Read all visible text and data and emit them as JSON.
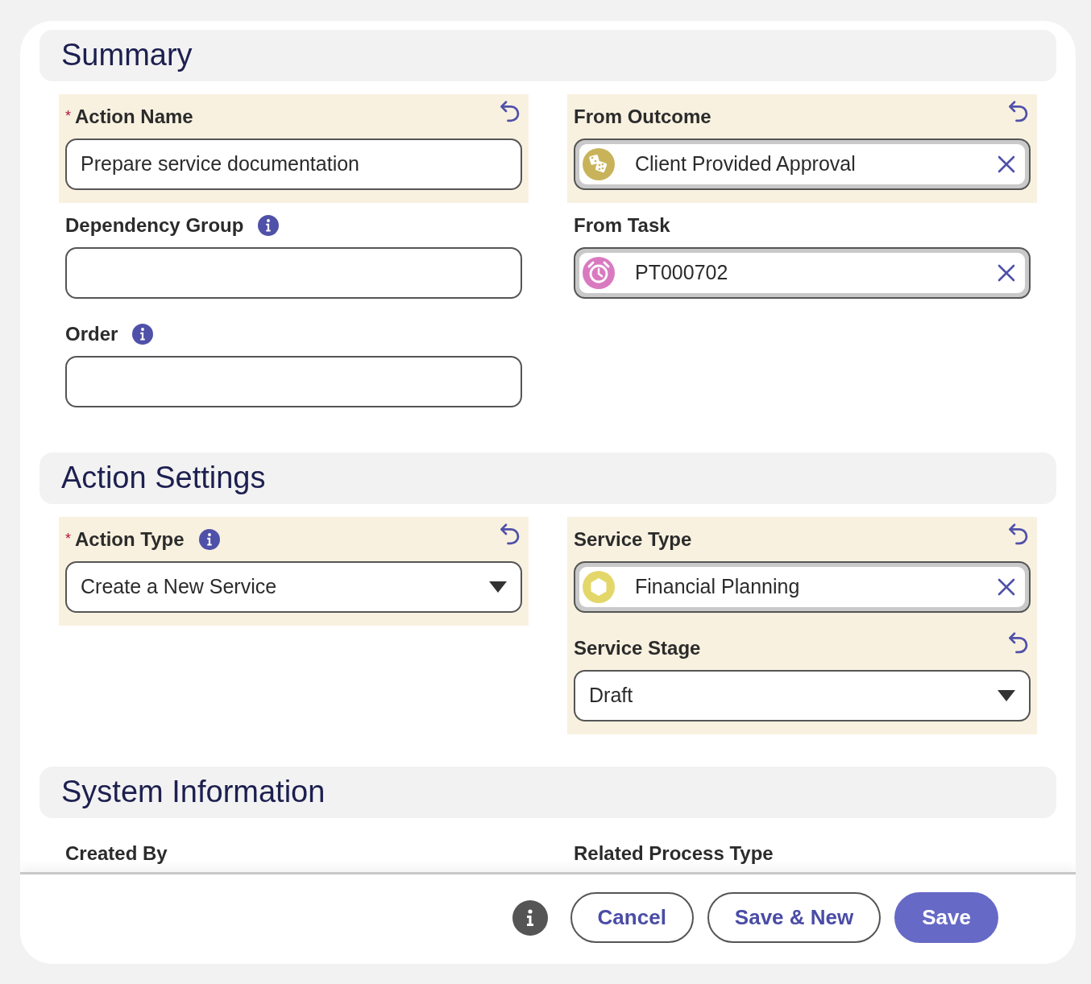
{
  "sections": [
    {
      "title": "Summary",
      "columns": [
        [
          {
            "label": "Action Name",
            "required_mark": "*",
            "undo": true,
            "highlighted": true,
            "kind": "text",
            "value": "Prepare service documentation"
          },
          {
            "label": "Dependency Group",
            "info": true,
            "kind": "text"
          },
          {
            "label": "Order",
            "info": true,
            "kind": "text"
          }
        ],
        [
          {
            "label": "From Outcome",
            "undo": true,
            "highlighted": true,
            "kind": "lookup",
            "value": "Client Provided Approval"
          },
          {
            "label": "From Task",
            "kind": "lookup",
            "value": "PT000702"
          }
        ]
      ]
    },
    {
      "title": "Action Settings",
      "columns": [
        [
          {
            "label": "Action Type",
            "required_mark": "*",
            "info": true,
            "undo": true,
            "highlighted": true,
            "kind": "select",
            "value": "Create a New Service"
          }
        ],
        [
          {
            "label": "Service Type",
            "undo": true,
            "highlighted": true,
            "kind": "lookup",
            "value": "Financial Planning"
          },
          {
            "label": "Service Stage",
            "undo": true,
            "highlighted": true,
            "kind": "select",
            "value": "Draft"
          }
        ]
      ]
    },
    {
      "title": "System Information",
      "columns": [
        [
          {
            "label": "Created By",
            "kind": "readonly"
          }
        ],
        [
          {
            "label": "Related Process Type",
            "kind": "readonly"
          }
        ]
      ]
    }
  ],
  "footer": {
    "buttons": [
      {
        "label": "Cancel",
        "primary": false
      },
      {
        "label": "Save & New",
        "primary": false
      },
      {
        "label": "Save",
        "primary": true
      }
    ]
  }
}
